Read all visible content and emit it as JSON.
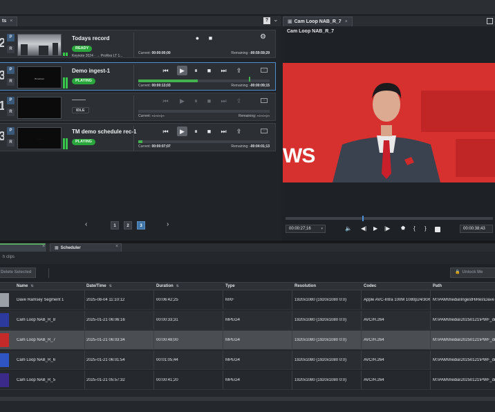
{
  "header": {
    "help_label": "?",
    "collapse_glyph": "⌄"
  },
  "left_panel": {
    "tab_label": "ts",
    "tab_close": "×"
  },
  "right_panel": {
    "tab_label": "Cam Loop NAB_R_7",
    "tab_close": "×"
  },
  "recorders": [
    {
      "num": "2",
      "name": "Todays record",
      "status": "READY",
      "meta": "Keynote 2024  ·  → ProRes LT 1...",
      "current_label": "Current:",
      "current": "00:00:00;00",
      "remaining_label": "Remaining:",
      "remaining": "-00:59:59;29",
      "progress": 0,
      "mode": "record"
    },
    {
      "num": "3",
      "name": "Demo ingest-1",
      "status": "PLAYING",
      "meta": "",
      "current_label": "Current:",
      "current": "00:00:13;03",
      "remaining_label": "Remaining:",
      "remaining": "-00:00:09;15",
      "progress": 0.45,
      "mode": "play"
    },
    {
      "num": "1",
      "name": "",
      "status": "IDLE",
      "meta": "",
      "current_label": "Current:",
      "current": "--:--:--;--",
      "remaining_label": "Remaining:",
      "remaining": "--:--:--;--",
      "progress": 0,
      "mode": "idle"
    },
    {
      "num": "3",
      "name": "TM demo schedule rec-1",
      "status": "PLAYING",
      "meta": "",
      "current_label": "Current:",
      "current": "00:00:07;07",
      "remaining_label": "Remaining:",
      "remaining": "-00:04:01;13",
      "progress": 0.03,
      "mode": "play"
    }
  ],
  "thumb_text": {
    "demo": "Broadcast"
  },
  "pager": {
    "prev": "‹",
    "next": "›",
    "pages": [
      "1",
      "2",
      "3"
    ],
    "active_page": "3"
  },
  "player": {
    "title": "Cam Loop NAB_R_7",
    "overlay_text": "WS",
    "current_time": "00:00:27;16",
    "duration": "00:00:38;43",
    "dropdown_glyph": "▾"
  },
  "bottom_tabs": [
    {
      "label": "",
      "close": "×"
    },
    {
      "label": "Scheduler",
      "close": "×"
    }
  ],
  "filter": {
    "label": "h clips"
  },
  "toolbar": {
    "delete_label": "Delete Selected",
    "unlock_label": "Unlock Me"
  },
  "table": {
    "columns": [
      "Name",
      "Date/Time",
      "Duration",
      "Type",
      "Resolution",
      "Codec",
      "Path"
    ],
    "sort_glyph": "⇅",
    "rows": [
      {
        "name": "Dave Ramsey Segment 1",
        "datetime": "2025-08-04 11:10:12",
        "duration": "00:06:42;25",
        "type": "MXF",
        "resolution": "1920x1080 (1920x1080 0:0)",
        "codec": "Apple AVC-Intra 100M 1080p24/30/6",
        "path": "M:\\PAM\\media\\IngestHiRes\\Dave R",
        "thumb": "#9aa0a6",
        "selected": false
      },
      {
        "name": "Cam Loop NAB_R_8",
        "datetime": "2025-01-21 06:06:16",
        "duration": "00:00:33;31",
        "type": "MPEG4",
        "resolution": "1920x1080 (1920x1080 0:0)",
        "codec": "AVC/H.264",
        "path": "M:\\PAM\\media\\20250121\\PWF_dd2fe",
        "thumb": "#2b3a9c",
        "selected": false
      },
      {
        "name": "Cam Loop NAB_R_7",
        "datetime": "2025-01-21 06:03:34",
        "duration": "00:00:48;00",
        "type": "MPEG4",
        "resolution": "1920x1080 (1920x1080 0:0)",
        "codec": "AVC/H.264",
        "path": "M:\\PAM\\media\\20250121\\PWF_dd2fe",
        "thumb": "#c42a2a",
        "selected": true
      },
      {
        "name": "Cam Loop NAB_R_6",
        "datetime": "2025-01-21 06:01:54",
        "duration": "00:01:05;44",
        "type": "MPEG4",
        "resolution": "1920x1080 (1920x1080 0:0)",
        "codec": "AVC/H.264",
        "path": "M:\\PAM\\media\\20250121\\PWF_dd2fe",
        "thumb": "#2f54c4",
        "selected": false
      },
      {
        "name": "Cam Loop NAB_R_5",
        "datetime": "2025-01-21 05:57:32",
        "duration": "00:00:41;20",
        "type": "MPEG4",
        "resolution": "1920x1080 (1920x1080 0:0)",
        "codec": "AVC/H.264",
        "path": "M:\\PAM\\media\\20250121\\PWF_dd2fe",
        "thumb": "#3b2a8a",
        "selected": false
      }
    ]
  },
  "icons": {
    "record": "●",
    "stop": "■",
    "gear": "⚙",
    "skip_back": "⏮",
    "play": "▶",
    "pause": "⏸",
    "skip_fwd": "⏭",
    "export": "⇪",
    "step_back": "◀",
    "step_fwd": "▶",
    "volume": "🔈",
    "marker": "⬟",
    "in_point": "{",
    "out_point": "}",
    "save": "💾",
    "lock": "🔒"
  },
  "colors": {
    "accent": "#3f74a8",
    "playing": "#2aa63d",
    "video_bg": "#d6302f",
    "selected_row": "#4a4e53"
  }
}
